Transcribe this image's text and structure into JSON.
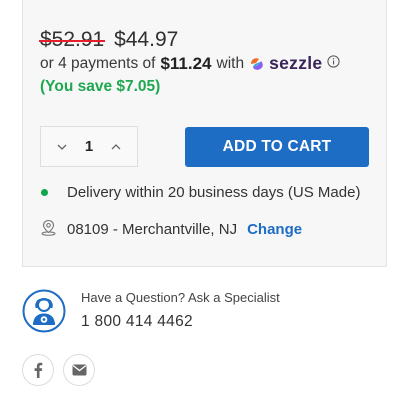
{
  "price": {
    "original": "$52.91",
    "current": "$44.97"
  },
  "installments": {
    "prefix": "or 4 payments of",
    "amount": "$11.24",
    "with": "with",
    "provider": "sezzle",
    "icon": "info-icon"
  },
  "savings": "(You save $7.05)",
  "quantity": {
    "value": "1",
    "decrement_icon": "chevron-down-icon",
    "increment_icon": "chevron-up-icon"
  },
  "add_to_cart": "ADD TO CART",
  "delivery": {
    "text": "Delivery within 20 business days (US Made)",
    "status_color": "#12a64a"
  },
  "location": {
    "text": "08109 - Merchantville, NJ",
    "change_label": "Change",
    "icon": "map-pin-icon"
  },
  "specialist": {
    "question": "Have a Question? Ask a Specialist",
    "phone": "1 800 414 4462",
    "icon": "specialist-avatar-icon"
  },
  "social": [
    {
      "name": "facebook",
      "icon": "facebook-icon"
    },
    {
      "name": "email",
      "icon": "mail-icon"
    }
  ],
  "colors": {
    "accent": "#1e6dc5",
    "savings": "#1fa84f",
    "strike": "#e5202a",
    "panel_bg": "#f7f7f7"
  }
}
